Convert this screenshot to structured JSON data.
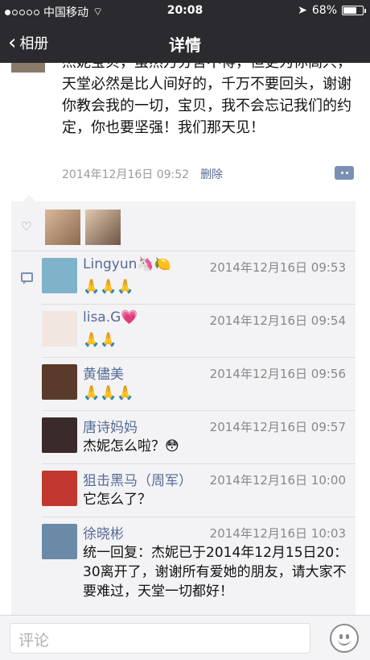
{
  "status_bar": {
    "carrier": "中国移动",
    "time": "20:08",
    "battery": "68%"
  },
  "nav": {
    "back_label": "相册",
    "title": "详情"
  },
  "post": {
    "text": "杰妮宝贝，虽然万分舍不得，但更为你高兴，天堂必然是比人间好的，千万不要回头，谢谢你教会我的一切，宝贝，我不会忘记我们的约定，你也要坚强！我们那天见！",
    "time": "2014年12月16日 09:52",
    "delete_label": "删除"
  },
  "comments": [
    {
      "name": "Lingyun🦄🍋",
      "time": "2014年12月16日 09:53",
      "text": "🙏🙏🙏",
      "avatar_color": "#7fb3c9"
    },
    {
      "name": "lisa.G💗",
      "time": "2014年12月16日 09:54",
      "text": "🙏🙏",
      "avatar_color": "#f2e6e0"
    },
    {
      "name": "黄儘美",
      "time": "2014年12月16日 09:56",
      "text": "🙏🙏🙏",
      "avatar_color": "#5a3a2a"
    },
    {
      "name": "唐诗妈妈",
      "time": "2014年12月16日 09:57",
      "text": "杰妮怎么啦？😳",
      "avatar_color": "#3a2a2a"
    },
    {
      "name": "狙击黑马（周军）",
      "time": "2014年12月16日 10:00",
      "text": "它怎么了？",
      "avatar_color": "#c2372f"
    },
    {
      "name": "徐晓彬",
      "time": "2014年12月16日 10:03",
      "text": "统一回复：杰妮已于2014年12月15日20：30离开了，谢谢所有爱她的朋友，请大家不要难过，天堂一切都好！",
      "avatar_color": "#6a8aa8"
    }
  ],
  "input": {
    "placeholder": "评论"
  },
  "colors": {
    "bar": "#2b2b2f",
    "link": "#576b95",
    "panel": "#f3f3f5"
  }
}
